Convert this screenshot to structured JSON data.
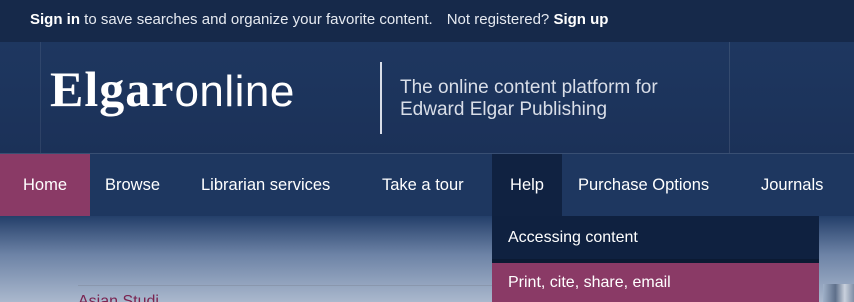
{
  "topbar": {
    "sign_in": "Sign in",
    "sign_in_suffix": " to save searches and organize your favorite content.",
    "not_registered": "Not registered?",
    "sign_up": "Sign up"
  },
  "header": {
    "logo_bold": "Elgar",
    "logo_light": "online",
    "tagline_line1": "The online content platform for",
    "tagline_line2": "Edward Elgar Publishing"
  },
  "nav": {
    "items": [
      {
        "label": "Home",
        "active": true
      },
      {
        "label": "Browse"
      },
      {
        "label": "Librarian services"
      },
      {
        "label": "Take a tour"
      },
      {
        "label": "Help",
        "open": true
      },
      {
        "label": "Purchase Options"
      },
      {
        "label": "Journals"
      }
    ]
  },
  "help_menu": {
    "items": [
      {
        "label": "Accessing content"
      },
      {
        "label": "Print, cite, share, email",
        "highlighted": true
      }
    ]
  },
  "content": {
    "partial_heading": "Asian Studi..."
  },
  "colors": {
    "navy": "#1b2f52",
    "plum": "#8a3a66",
    "dark_navy": "#102241"
  }
}
